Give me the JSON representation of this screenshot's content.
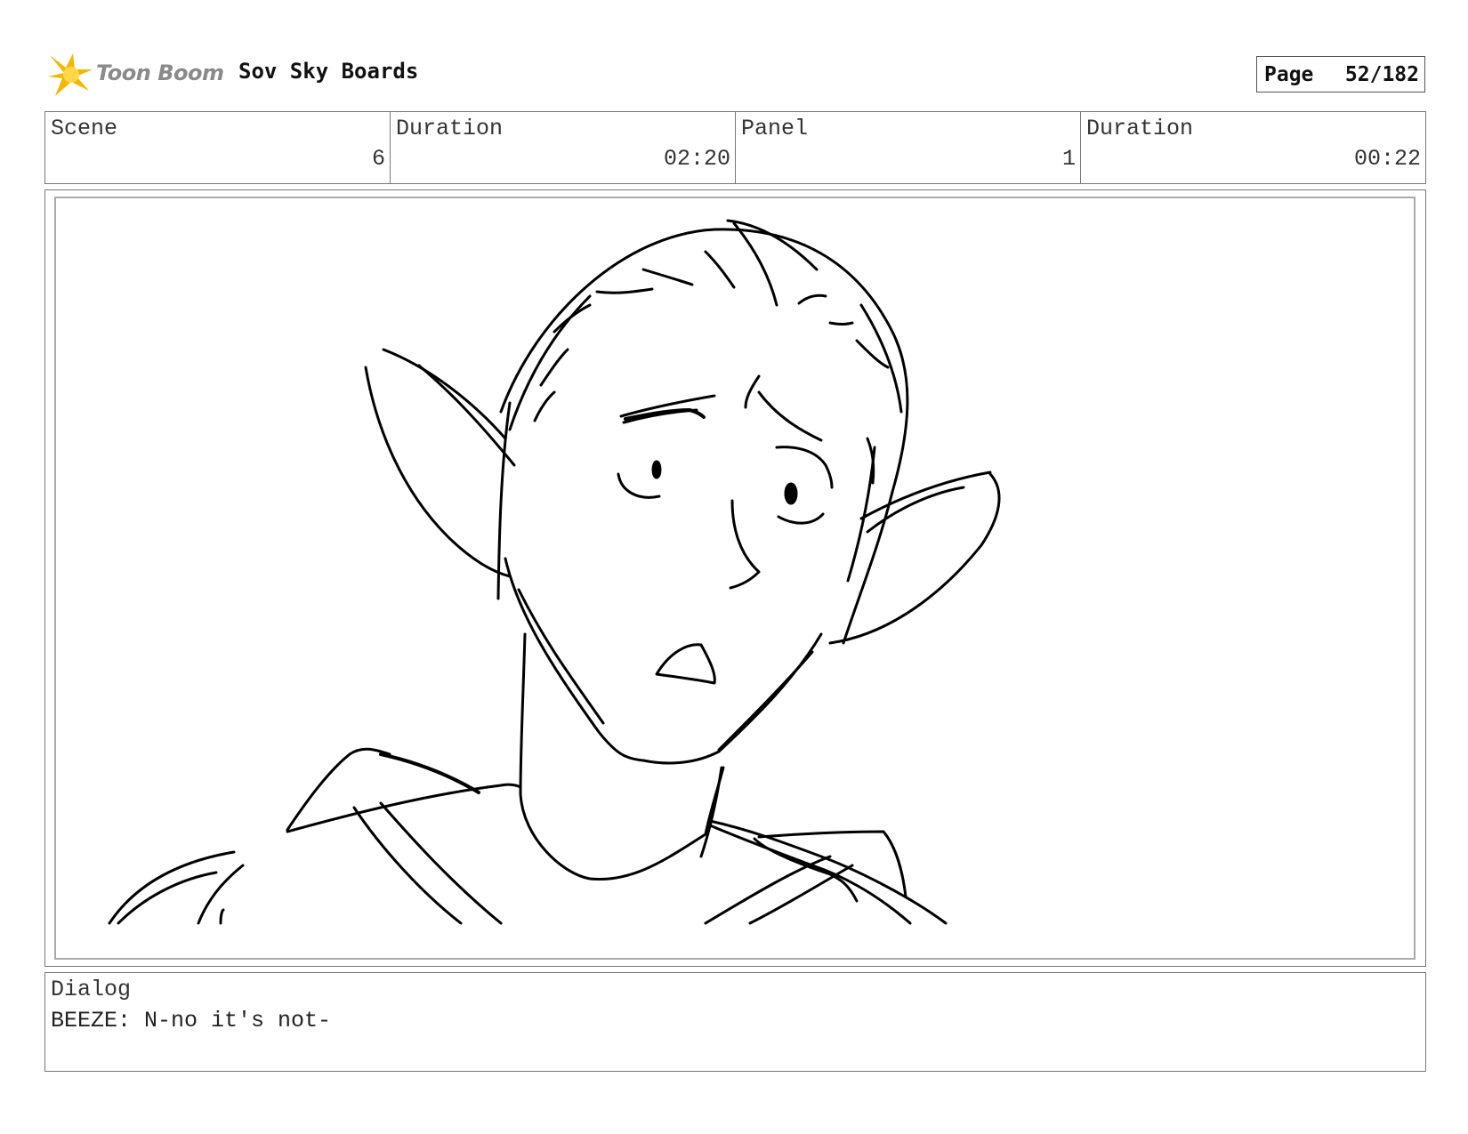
{
  "header": {
    "logo_text": "Toon Boom",
    "project_title": "Sov Sky Boards",
    "page_label": "Page",
    "page_value": "52/182"
  },
  "info": {
    "scene_label": "Scene",
    "scene_value": "6",
    "scene_duration_label": "Duration",
    "scene_duration_value": "02:20",
    "panel_label": "Panel",
    "panel_value": "1",
    "panel_duration_label": "Duration",
    "panel_duration_value": "00:22"
  },
  "dialog": {
    "label": "Dialog",
    "text": "BEEZE: N-no it's not-"
  },
  "icons": {
    "logo": "toon-boom-star-icon"
  },
  "colors": {
    "logo_star": "#f5b800",
    "logo_text": "#8a8a8a"
  }
}
